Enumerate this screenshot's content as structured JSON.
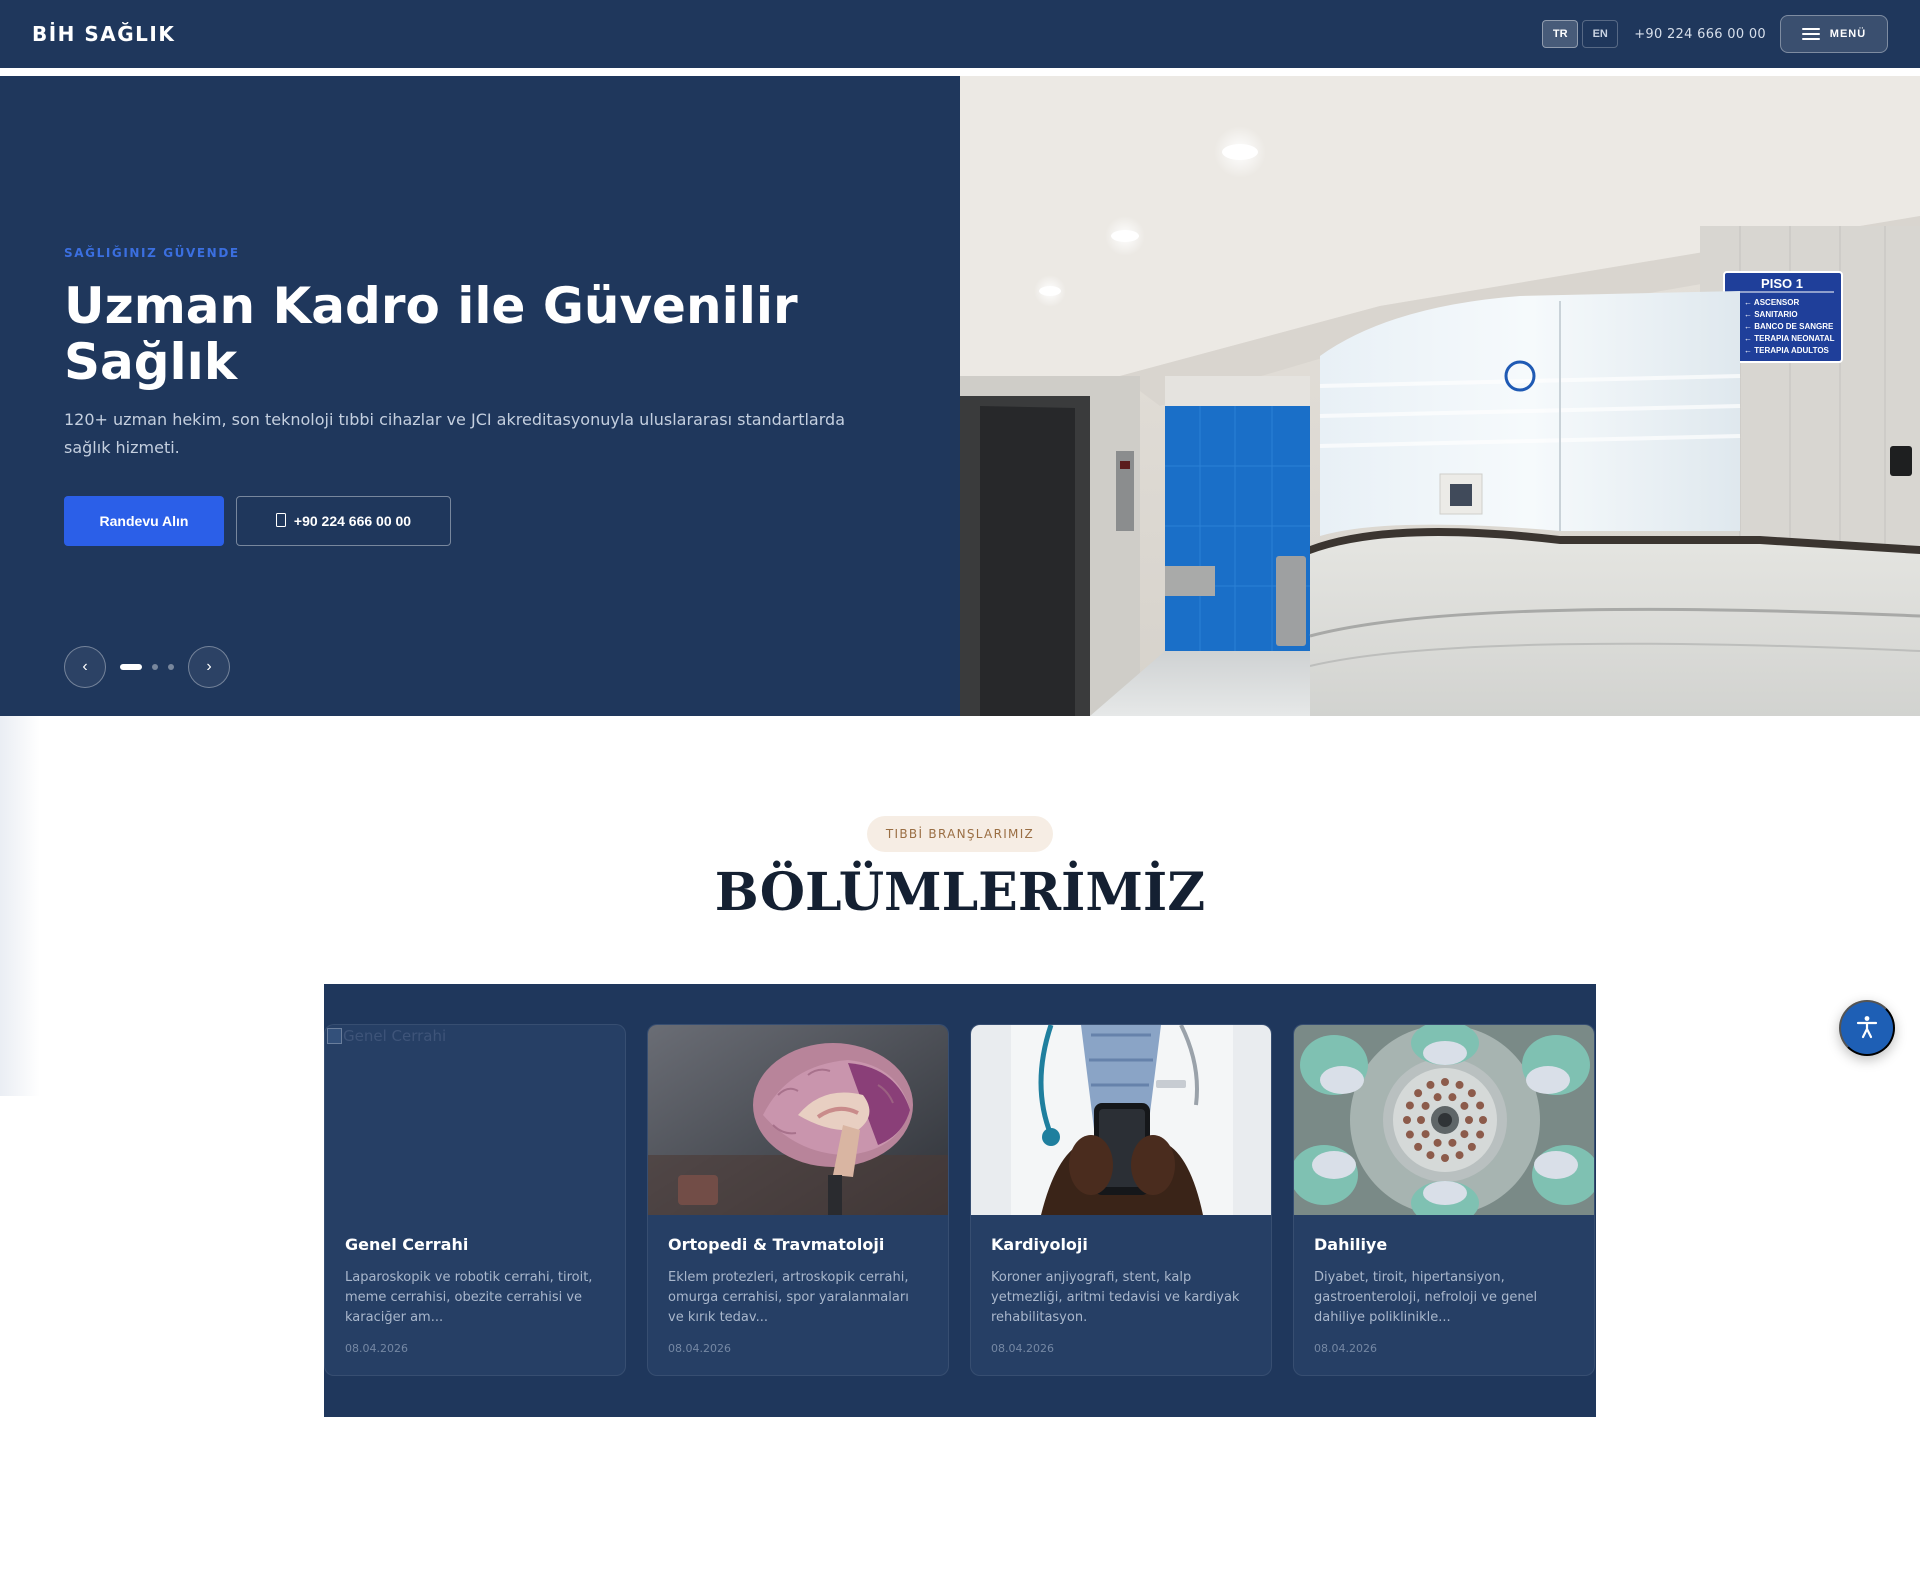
{
  "header": {
    "logo": "BİH SAĞLIK",
    "lang_tr": "TR",
    "lang_en": "EN",
    "phone": "+90 224 666 00 00",
    "menu_label": "MENÜ"
  },
  "hero": {
    "eyebrow": "SAĞLIĞINIZ GÜVENDE",
    "title": "Uzman Kadro ile Güvenilir Sağlık",
    "description": "120+ uzman hekim, son teknoloji tıbbi cihazlar ve JCI akreditasyonuyla uluslararası standartlarda sağlık hizmeti.",
    "primary_button": "Randevu Alın",
    "phone_button": "+90 224 666 00 00",
    "prev_glyph": "‹",
    "next_glyph": "›",
    "slide_count": 3,
    "active_slide": 1,
    "sign": {
      "title": "PISO 1",
      "lines": [
        "ASCENSOR",
        "SANITARIO",
        "BANCO DE SANGRE",
        "TERAPIA NEONATAL",
        "TERAPIA ADULTOS"
      ]
    }
  },
  "section": {
    "badge": "TIBBİ BRANŞLARIMIZ",
    "title": "BÖLÜMLERİMİZ"
  },
  "departments": [
    {
      "title": "Genel Cerrahi",
      "image_alt": "Genel Cerrahi",
      "description": "Laparoskopik ve robotik cerrahi, tiroit, meme cerrahisi, obezite cerrahisi ve karaciğer am...",
      "date": "08.04.2026"
    },
    {
      "title": "Ortopedi & Travmatoloji",
      "description": "Eklem protezleri, artroskopik cerrahi, omurga cerrahisi, spor yaralanmaları ve kırık tedav...",
      "date": "08.04.2026"
    },
    {
      "title": "Kardiyoloji",
      "description": "Koroner anjiyografi, stent, kalp yetmezliği, aritmi tedavisi ve kardiyak rehabilitasyon.",
      "date": "08.04.2026"
    },
    {
      "title": "Dahiliye",
      "description": "Diyabet, tiroit, hipertansiyon, gastroenteroloji, nefroloji ve genel dahiliye poliklinikle...",
      "date": "08.04.2026"
    }
  ],
  "colors": {
    "navy": "#1f375c",
    "accent_blue": "#2b5fe8",
    "card_bg": "#263f65",
    "badge_bg": "#f6ede4",
    "badge_text": "#9a6e43"
  },
  "icons": {
    "menu": "hamburger-icon",
    "phone": "phone-icon",
    "accessibility": "accessibility-icon"
  }
}
